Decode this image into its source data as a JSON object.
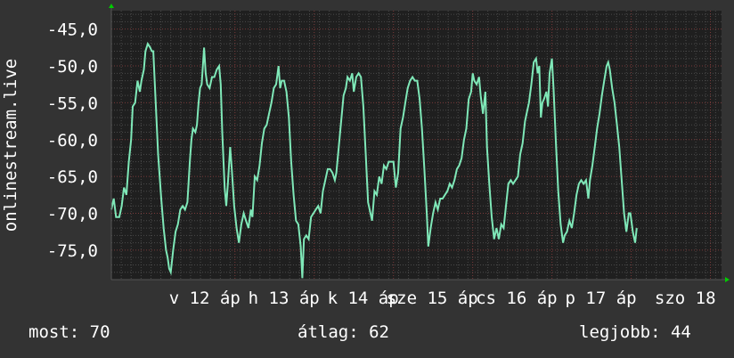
{
  "chart_data": {
    "type": "line",
    "ylabel": "onlinestream.live",
    "y_ticks": [
      "-45,0",
      "-50,0",
      "-55,0",
      "-60,0",
      "-65,0",
      "-70,0",
      "-75,0"
    ],
    "y_tick_values": [
      -45,
      -50,
      -55,
      -60,
      -65,
      -70,
      -75
    ],
    "ylim": [
      -79,
      -42.5
    ],
    "x_ticks": [
      {
        "label": "v 12 áp",
        "at": 1.56
      },
      {
        "label": "h 13 áp",
        "at": 2.56
      },
      {
        "label": "k 14 áp",
        "at": 3.56
      },
      {
        "label": "sze 15 áp",
        "at": 4.56
      },
      {
        "label": "cs 16 áp",
        "at": 5.56
      },
      {
        "label": "p 17 áp",
        "at": 6.56
      },
      {
        "label": "szo 18",
        "at": 7.56
      }
    ],
    "xlim": [
      0,
      7.7
    ],
    "grid": true,
    "colors": {
      "background": "#333333",
      "plot_area": "#1f1f1f",
      "line": "#7fe8b8",
      "axis_arrow": "#00cc00",
      "grid_major": "#7a3a3a",
      "grid_minor": "#4a4a4a"
    },
    "series": [
      {
        "values": [
          [
            0.0,
            -69.5
          ],
          [
            0.03,
            -68.0
          ],
          [
            0.06,
            -70.5
          ],
          [
            0.1,
            -70.5
          ],
          [
            0.13,
            -69.0
          ],
          [
            0.16,
            -66.5
          ],
          [
            0.19,
            -67.5
          ],
          [
            0.22,
            -63.0
          ],
          [
            0.25,
            -60.0
          ],
          [
            0.27,
            -55.5
          ],
          [
            0.3,
            -55.0
          ],
          [
            0.33,
            -52.0
          ],
          [
            0.36,
            -53.5
          ],
          [
            0.38,
            -52.0
          ],
          [
            0.41,
            -50.5
          ],
          [
            0.43,
            -48.0
          ],
          [
            0.46,
            -47.0
          ],
          [
            0.49,
            -47.5
          ],
          [
            0.51,
            -48.0
          ],
          [
            0.53,
            -48.0
          ],
          [
            0.56,
            -55.0
          ],
          [
            0.59,
            -62.0
          ],
          [
            0.63,
            -68.0
          ],
          [
            0.66,
            -72.0
          ],
          [
            0.69,
            -75.0
          ],
          [
            0.71,
            -76.0
          ],
          [
            0.73,
            -77.5
          ],
          [
            0.75,
            -78.0
          ],
          [
            0.78,
            -75.0
          ],
          [
            0.81,
            -72.5
          ],
          [
            0.84,
            -71.5
          ],
          [
            0.87,
            -69.5
          ],
          [
            0.9,
            -69.0
          ],
          [
            0.93,
            -69.5
          ],
          [
            0.96,
            -68.5
          ],
          [
            0.99,
            -63.0
          ],
          [
            1.01,
            -60.0
          ],
          [
            1.03,
            -58.5
          ],
          [
            1.06,
            -59.0
          ],
          [
            1.08,
            -58.0
          ],
          [
            1.1,
            -55.0
          ],
          [
            1.12,
            -53.0
          ],
          [
            1.14,
            -52.5
          ],
          [
            1.17,
            -47.5
          ],
          [
            1.19,
            -51.0
          ],
          [
            1.21,
            -52.5
          ],
          [
            1.24,
            -53.0
          ],
          [
            1.27,
            -51.5
          ],
          [
            1.3,
            -51.5
          ],
          [
            1.33,
            -50.5
          ],
          [
            1.36,
            -50.0
          ],
          [
            1.38,
            -52.5
          ],
          [
            1.4,
            -59.0
          ],
          [
            1.43,
            -66.5
          ],
          [
            1.45,
            -69.0
          ],
          [
            1.47,
            -66.0
          ],
          [
            1.5,
            -61.0
          ],
          [
            1.52,
            -64.0
          ],
          [
            1.55,
            -69.0
          ],
          [
            1.58,
            -72.0
          ],
          [
            1.61,
            -74.0
          ],
          [
            1.64,
            -71.5
          ],
          [
            1.67,
            -70.0
          ],
          [
            1.7,
            -71.0
          ],
          [
            1.73,
            -72.0
          ],
          [
            1.76,
            -69.5
          ],
          [
            1.78,
            -70.5
          ],
          [
            1.81,
            -65.0
          ],
          [
            1.84,
            -65.5
          ],
          [
            1.87,
            -63.5
          ],
          [
            1.9,
            -60.5
          ],
          [
            1.93,
            -58.5
          ],
          [
            1.96,
            -58.0
          ],
          [
            1.99,
            -56.5
          ],
          [
            2.02,
            -55.0
          ],
          [
            2.05,
            -53.0
          ],
          [
            2.08,
            -52.5
          ],
          [
            2.11,
            -50.0
          ],
          [
            2.13,
            -53.0
          ],
          [
            2.15,
            -52.0
          ],
          [
            2.18,
            -52.0
          ],
          [
            2.21,
            -53.5
          ],
          [
            2.24,
            -57.0
          ],
          [
            2.27,
            -63.0
          ],
          [
            2.3,
            -67.5
          ],
          [
            2.33,
            -71.0
          ],
          [
            2.36,
            -71.5
          ],
          [
            2.39,
            -74.5
          ],
          [
            2.41,
            -78.8
          ],
          [
            2.43,
            -73.5
          ],
          [
            2.46,
            -73.0
          ],
          [
            2.49,
            -73.5
          ],
          [
            2.52,
            -70.5
          ],
          [
            2.55,
            -70.0
          ],
          [
            2.58,
            -69.5
          ],
          [
            2.61,
            -69.0
          ],
          [
            2.64,
            -70.0
          ],
          [
            2.67,
            -67.0
          ],
          [
            2.7,
            -65.5
          ],
          [
            2.73,
            -64.0
          ],
          [
            2.76,
            -64.0
          ],
          [
            2.79,
            -64.5
          ],
          [
            2.82,
            -65.5
          ],
          [
            2.84,
            -64.5
          ],
          [
            2.87,
            -61.0
          ],
          [
            2.9,
            -57.5
          ],
          [
            2.93,
            -54.0
          ],
          [
            2.96,
            -53.0
          ],
          [
            2.98,
            -51.5
          ],
          [
            3.01,
            -52.0
          ],
          [
            3.04,
            -51.0
          ],
          [
            3.06,
            -53.5
          ],
          [
            3.09,
            -51.5
          ],
          [
            3.12,
            -51.0
          ],
          [
            3.15,
            -51.5
          ],
          [
            3.18,
            -55.5
          ],
          [
            3.21,
            -62.0
          ],
          [
            3.24,
            -68.5
          ],
          [
            3.27,
            -70.0
          ],
          [
            3.29,
            -71.0
          ],
          [
            3.32,
            -67.0
          ],
          [
            3.35,
            -67.5
          ],
          [
            3.38,
            -65.0
          ],
          [
            3.41,
            -66.0
          ],
          [
            3.44,
            -63.5
          ],
          [
            3.47,
            -64.0
          ],
          [
            3.5,
            -63.0
          ],
          [
            3.53,
            -63.0
          ],
          [
            3.56,
            -63.0
          ],
          [
            3.59,
            -66.5
          ],
          [
            3.62,
            -64.5
          ],
          [
            3.65,
            -58.5
          ],
          [
            3.68,
            -57.0
          ],
          [
            3.71,
            -55.0
          ],
          [
            3.74,
            -53.0
          ],
          [
            3.77,
            -52.0
          ],
          [
            3.8,
            -51.5
          ],
          [
            3.83,
            -52.0
          ],
          [
            3.86,
            -52.0
          ],
          [
            3.89,
            -54.5
          ],
          [
            3.92,
            -58.5
          ],
          [
            3.95,
            -64.0
          ],
          [
            3.98,
            -70.0
          ],
          [
            4.0,
            -74.5
          ],
          [
            4.03,
            -72.0
          ],
          [
            4.06,
            -70.0
          ],
          [
            4.09,
            -68.5
          ],
          [
            4.12,
            -69.5
          ],
          [
            4.15,
            -68.0
          ],
          [
            4.18,
            -68.0
          ],
          [
            4.21,
            -67.5
          ],
          [
            4.24,
            -67.0
          ],
          [
            4.27,
            -66.0
          ],
          [
            4.3,
            -66.5
          ],
          [
            4.33,
            -65.5
          ],
          [
            4.36,
            -64.0
          ],
          [
            4.39,
            -63.5
          ],
          [
            4.42,
            -62.5
          ],
          [
            4.45,
            -60.0
          ],
          [
            4.48,
            -58.5
          ],
          [
            4.51,
            -54.5
          ],
          [
            4.54,
            -53.5
          ],
          [
            4.56,
            -51.0
          ],
          [
            4.58,
            -52.0
          ],
          [
            4.61,
            -52.5
          ],
          [
            4.64,
            -51.5
          ],
          [
            4.66,
            -54.0
          ],
          [
            4.69,
            -56.5
          ],
          [
            4.72,
            -53.5
          ],
          [
            4.74,
            -61.0
          ],
          [
            4.77,
            -66.0
          ],
          [
            4.8,
            -70.5
          ],
          [
            4.83,
            -73.5
          ],
          [
            4.86,
            -72.0
          ],
          [
            4.89,
            -73.5
          ],
          [
            4.92,
            -71.5
          ],
          [
            4.95,
            -72.0
          ],
          [
            4.98,
            -69.0
          ],
          [
            5.01,
            -66.0
          ],
          [
            5.04,
            -65.5
          ],
          [
            5.07,
            -66.0
          ],
          [
            5.1,
            -65.5
          ],
          [
            5.13,
            -65.0
          ],
          [
            5.16,
            -62.0
          ],
          [
            5.19,
            -60.5
          ],
          [
            5.22,
            -57.5
          ],
          [
            5.25,
            -56.0
          ],
          [
            5.27,
            -55.0
          ],
          [
            5.3,
            -52.5
          ],
          [
            5.33,
            -49.5
          ],
          [
            5.36,
            -49.0
          ],
          [
            5.38,
            -51.0
          ],
          [
            5.4,
            -50.0
          ],
          [
            5.42,
            -57.0
          ],
          [
            5.44,
            -55.0
          ],
          [
            5.46,
            -54.5
          ],
          [
            5.49,
            -53.5
          ],
          [
            5.51,
            -55.5
          ],
          [
            5.53,
            -51.0
          ],
          [
            5.56,
            -49.0
          ],
          [
            5.58,
            -53.0
          ],
          [
            5.61,
            -60.5
          ],
          [
            5.64,
            -67.0
          ],
          [
            5.67,
            -71.5
          ],
          [
            5.7,
            -74.0
          ],
          [
            5.72,
            -73.0
          ],
          [
            5.75,
            -72.5
          ],
          [
            5.78,
            -71.0
          ],
          [
            5.81,
            -72.0
          ],
          [
            5.84,
            -70.0
          ],
          [
            5.87,
            -67.5
          ],
          [
            5.9,
            -66.0
          ],
          [
            5.93,
            -65.5
          ],
          [
            5.96,
            -66.0
          ],
          [
            5.99,
            -65.5
          ],
          [
            6.02,
            -68.0
          ],
          [
            6.04,
            -65.5
          ],
          [
            6.07,
            -63.5
          ],
          [
            6.1,
            -61.0
          ],
          [
            6.13,
            -58.5
          ],
          [
            6.16,
            -56.5
          ],
          [
            6.19,
            -54.0
          ],
          [
            6.22,
            -52.0
          ],
          [
            6.25,
            -50.0
          ],
          [
            6.27,
            -49.5
          ],
          [
            6.29,
            -50.5
          ],
          [
            6.32,
            -53.0
          ],
          [
            6.35,
            -55.0
          ],
          [
            6.38,
            -58.0
          ],
          [
            6.41,
            -61.0
          ],
          [
            6.44,
            -65.5
          ],
          [
            6.47,
            -70.0
          ],
          [
            6.5,
            -72.5
          ],
          [
            6.53,
            -70.0
          ],
          [
            6.55,
            -70.0
          ],
          [
            6.58,
            -72.5
          ],
          [
            6.61,
            -74.0
          ],
          [
            6.63,
            -72.0
          ]
        ]
      }
    ]
  },
  "stats": {
    "now": "most: 70",
    "avg": "átlag: 62",
    "best": "legjobb: 44"
  }
}
